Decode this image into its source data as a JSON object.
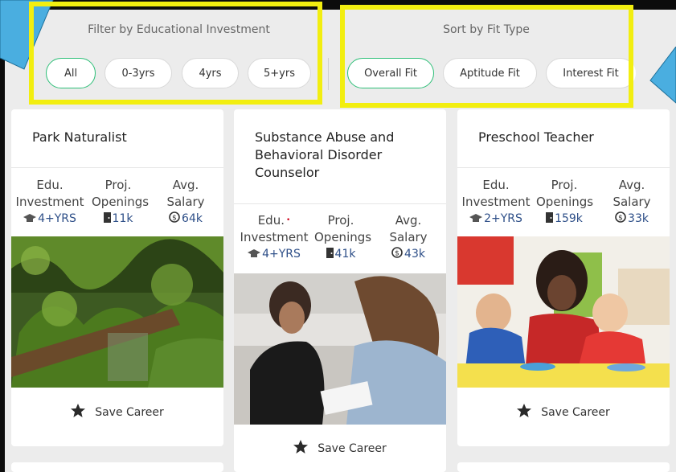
{
  "filters": {
    "edu_label": "Filter by Educational Investment",
    "edu_options": [
      "All",
      "0-3yrs",
      "4yrs",
      "5+yrs"
    ],
    "edu_selected": "All",
    "fit_label": "Sort by Fit Type",
    "fit_options": [
      "Overall Fit",
      "Aptitude Fit",
      "Interest Fit"
    ],
    "fit_selected": "Overall Fit"
  },
  "stat_labels": {
    "edu_line1": "Edu.",
    "edu_line2": "Investment",
    "proj_line1": "Proj.",
    "proj_line2": "Openings",
    "sal_line1": "Avg.",
    "sal_line2": "Salary"
  },
  "cards": [
    {
      "title": "Park Naturalist",
      "edu": "4+YRS",
      "openings": "11k",
      "salary": "64k",
      "save_label": "Save Career"
    },
    {
      "title": "Substance Abuse and Behavioral Disorder Counselor",
      "edu": "4+YRS",
      "openings": "41k",
      "salary": "43k",
      "save_label": "Save Career",
      "edu_required_mark": "•"
    },
    {
      "title": "Preschool Teacher",
      "edu": "2+YRS",
      "openings": "159k",
      "salary": "33k",
      "save_label": "Save Career"
    }
  ],
  "colors": {
    "highlight": "#f2ee10",
    "arrow": "#4aaee0",
    "active_pill": "#2ebf78",
    "stat_value": "#2e4f88"
  }
}
